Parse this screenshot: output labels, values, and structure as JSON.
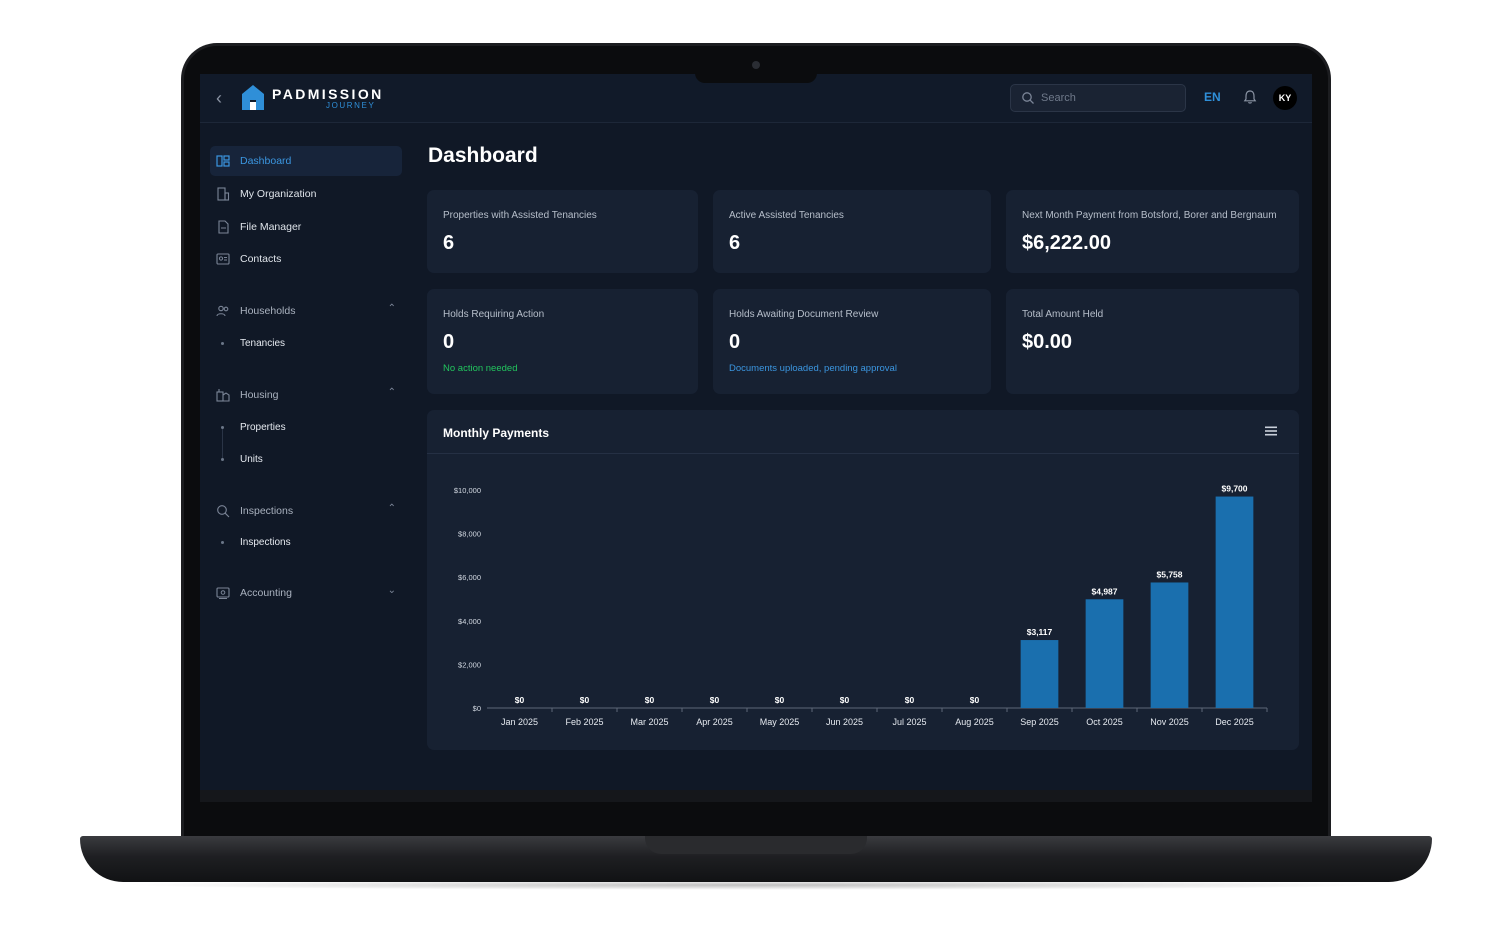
{
  "app": {
    "brand": "PADMISSION",
    "brand_sub": "JOURNEY",
    "back_icon": "chevron-left-icon"
  },
  "topbar": {
    "search_placeholder": "Search",
    "language": "EN",
    "avatar_initials": "KY"
  },
  "sidebar": {
    "items": [
      {
        "label": "Dashboard",
        "icon": "dashboard-icon",
        "active": true
      },
      {
        "label": "My Organization",
        "icon": "building-icon"
      },
      {
        "label": "File Manager",
        "icon": "file-icon"
      },
      {
        "label": "Contacts",
        "icon": "contacts-icon"
      }
    ],
    "groups": [
      {
        "label": "Households",
        "icon": "people-icon",
        "expanded": true,
        "children": [
          "Tenancies"
        ]
      },
      {
        "label": "Housing",
        "icon": "housing-icon",
        "expanded": true,
        "children": [
          "Properties",
          "Units"
        ]
      },
      {
        "label": "Inspections",
        "icon": "search-icon",
        "expanded": true,
        "children": [
          "Inspections"
        ]
      },
      {
        "label": "Accounting",
        "icon": "accounting-icon",
        "expanded": false,
        "children": []
      }
    ]
  },
  "main": {
    "title": "Dashboard",
    "cards": [
      {
        "label": "Properties with Assisted Tenancies",
        "value": "6",
        "note": ""
      },
      {
        "label": "Active Assisted Tenancies",
        "value": "6",
        "note": ""
      },
      {
        "label": "Next Month Payment from Botsford, Borer and Bergnaum",
        "value": "$6,222.00",
        "note": ""
      },
      {
        "label": "Holds Requiring Action",
        "value": "0",
        "note": "No action needed"
      },
      {
        "label": "Holds Awaiting Document Review",
        "value": "0",
        "note": "Documents uploaded, pending approval"
      },
      {
        "label": "Total Amount Held",
        "value": "$0.00",
        "note": ""
      }
    ]
  },
  "colors": {
    "accent": "#3b96e0",
    "bar": "#1a6fae",
    "success": "#22c55e",
    "background": "#101826",
    "card": "#172132"
  },
  "chart_data": {
    "type": "bar",
    "title": "Monthly Payments",
    "categories": [
      "Jan 2025",
      "Feb 2025",
      "Mar 2025",
      "Apr 2025",
      "May 2025",
      "Jun 2025",
      "Jul 2025",
      "Aug 2025",
      "Sep 2025",
      "Oct 2025",
      "Nov 2025",
      "Dec 2025"
    ],
    "values": [
      0,
      0,
      0,
      0,
      0,
      0,
      0,
      0,
      3117,
      4987,
      5758,
      9700
    ],
    "data_labels": [
      "$0",
      "$0",
      "$0",
      "$0",
      "$0",
      "$0",
      "$0",
      "$0",
      "$3,117",
      "$4,987",
      "$5,758",
      "$9,700"
    ],
    "y_ticks": [
      0,
      2000,
      4000,
      6000,
      8000,
      10000
    ],
    "y_tick_labels": [
      "$0",
      "$2,000",
      "$4,000",
      "$6,000",
      "$8,000",
      "$10,000"
    ],
    "ylim": [
      0,
      10000
    ],
    "grid": false,
    "xlabel": "",
    "ylabel": ""
  }
}
